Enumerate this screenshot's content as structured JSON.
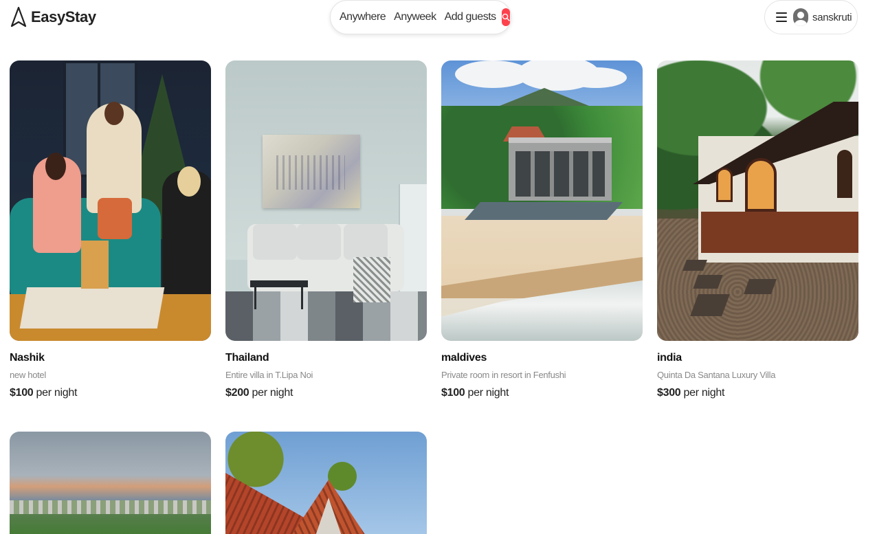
{
  "brand": {
    "name": "EasyStay"
  },
  "search": {
    "location": "Anywhere",
    "dates": "Anyweek",
    "guests": "Add guests"
  },
  "user": {
    "name": "sanskruti"
  },
  "colors": {
    "accent": "#fe424d"
  },
  "listings": [
    {
      "title": "Nashik",
      "subtitle": "new hotel",
      "price": "$100",
      "price_unit": " per night"
    },
    {
      "title": "Thailand",
      "subtitle": "Entire villa in T.Lipa Noi",
      "price": "$200",
      "price_unit": " per night"
    },
    {
      "title": "maldives",
      "subtitle": "Private room in resort in Fenfushi",
      "price": "$100",
      "price_unit": " per night"
    },
    {
      "title": "india",
      "subtitle": "Quinta Da Santana Luxury Villa",
      "price": "$300",
      "price_unit": " per night"
    }
  ],
  "icons": {
    "logo": "compass-logo-icon",
    "search": "search-icon",
    "menu": "hamburger-menu-icon",
    "avatar": "user-avatar-icon"
  }
}
